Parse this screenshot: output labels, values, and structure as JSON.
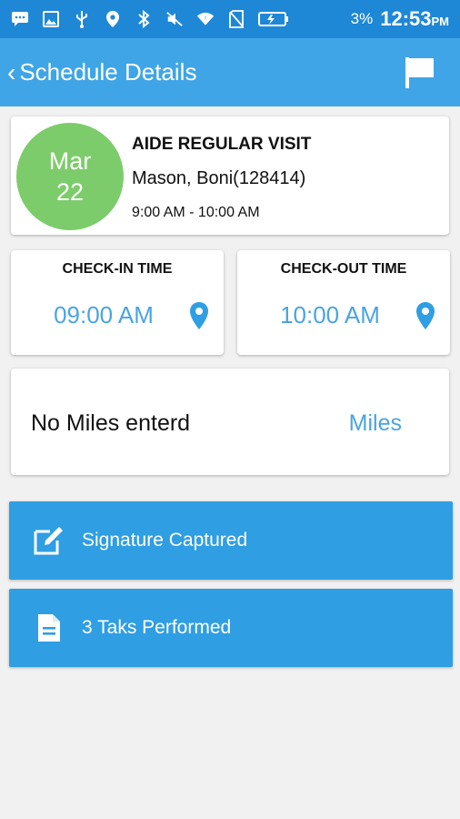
{
  "status_bar": {
    "battery_percent": "3%",
    "time": "12:53",
    "ampm": "PM",
    "icons": [
      "messaging-icon",
      "image-icon",
      "usb-icon",
      "location-icon",
      "bluetooth-icon",
      "vibrate-mute-icon",
      "wifi-icon",
      "no-sim-icon",
      "battery-icon"
    ]
  },
  "app_bar": {
    "back_symbol": "‹",
    "title": "Schedule Details",
    "flag_icon": "flag-icon"
  },
  "visit": {
    "month": "Mar",
    "day": "22",
    "type": "AIDE REGULAR VISIT",
    "patient": "Mason, Boni(128414)",
    "time_range": "9:00 AM - 10:00 AM",
    "date_color": "#7dcc6b"
  },
  "check_in": {
    "label": "CHECK-IN TIME",
    "time": "09:00 AM",
    "icon": "location-pin-icon"
  },
  "check_out": {
    "label": "CHECK-OUT TIME",
    "time": "10:00 AM",
    "icon": "location-pin-icon"
  },
  "miles": {
    "text": "No Miles enterd",
    "link": "Miles"
  },
  "actions": [
    {
      "label": "Signature Captured",
      "icon": "edit-signature-icon"
    },
    {
      "label": "3 Taks Performed",
      "icon": "document-icon"
    }
  ],
  "colors": {
    "status_bar": "#1e88d6",
    "app_bar": "#3fa5e6",
    "accent": "#4aa4e2",
    "button": "#2f9ee3",
    "background": "#f1f1f1"
  }
}
